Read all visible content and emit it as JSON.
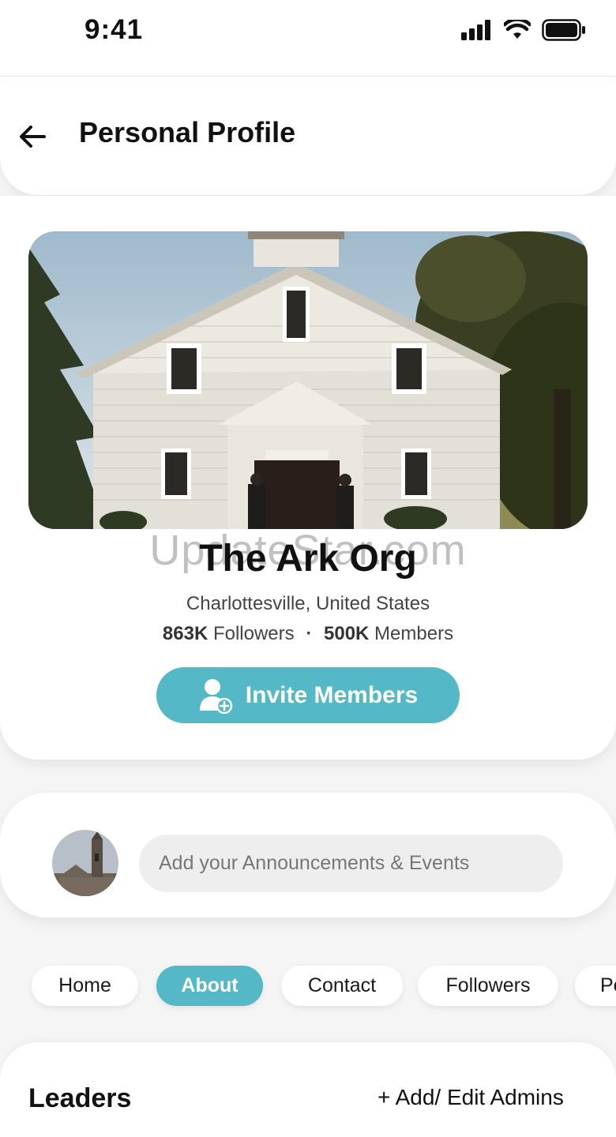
{
  "status_bar": {
    "time": "9:41"
  },
  "header": {
    "title": "Personal Profile"
  },
  "profile": {
    "watermark": "UpdateStar.com",
    "name": "The Ark Org",
    "location": "Charlottesville, United States",
    "followers_count": "863K",
    "followers_label": "Followers",
    "separator": "·",
    "members_count": "500K",
    "members_label": "Members",
    "invite_label": "Invite Members"
  },
  "announcement": {
    "placeholder": "Add your Announcements & Events"
  },
  "tabs": [
    {
      "label": "Home",
      "active": false
    },
    {
      "label": "About",
      "active": true
    },
    {
      "label": "Contact",
      "active": false
    },
    {
      "label": "Followers",
      "active": false
    },
    {
      "label": "Po",
      "active": false
    }
  ],
  "leaders": {
    "title": "Leaders",
    "admin_link": "+ Add/ Edit Admins"
  },
  "colors": {
    "accent": "#54b8c7"
  }
}
